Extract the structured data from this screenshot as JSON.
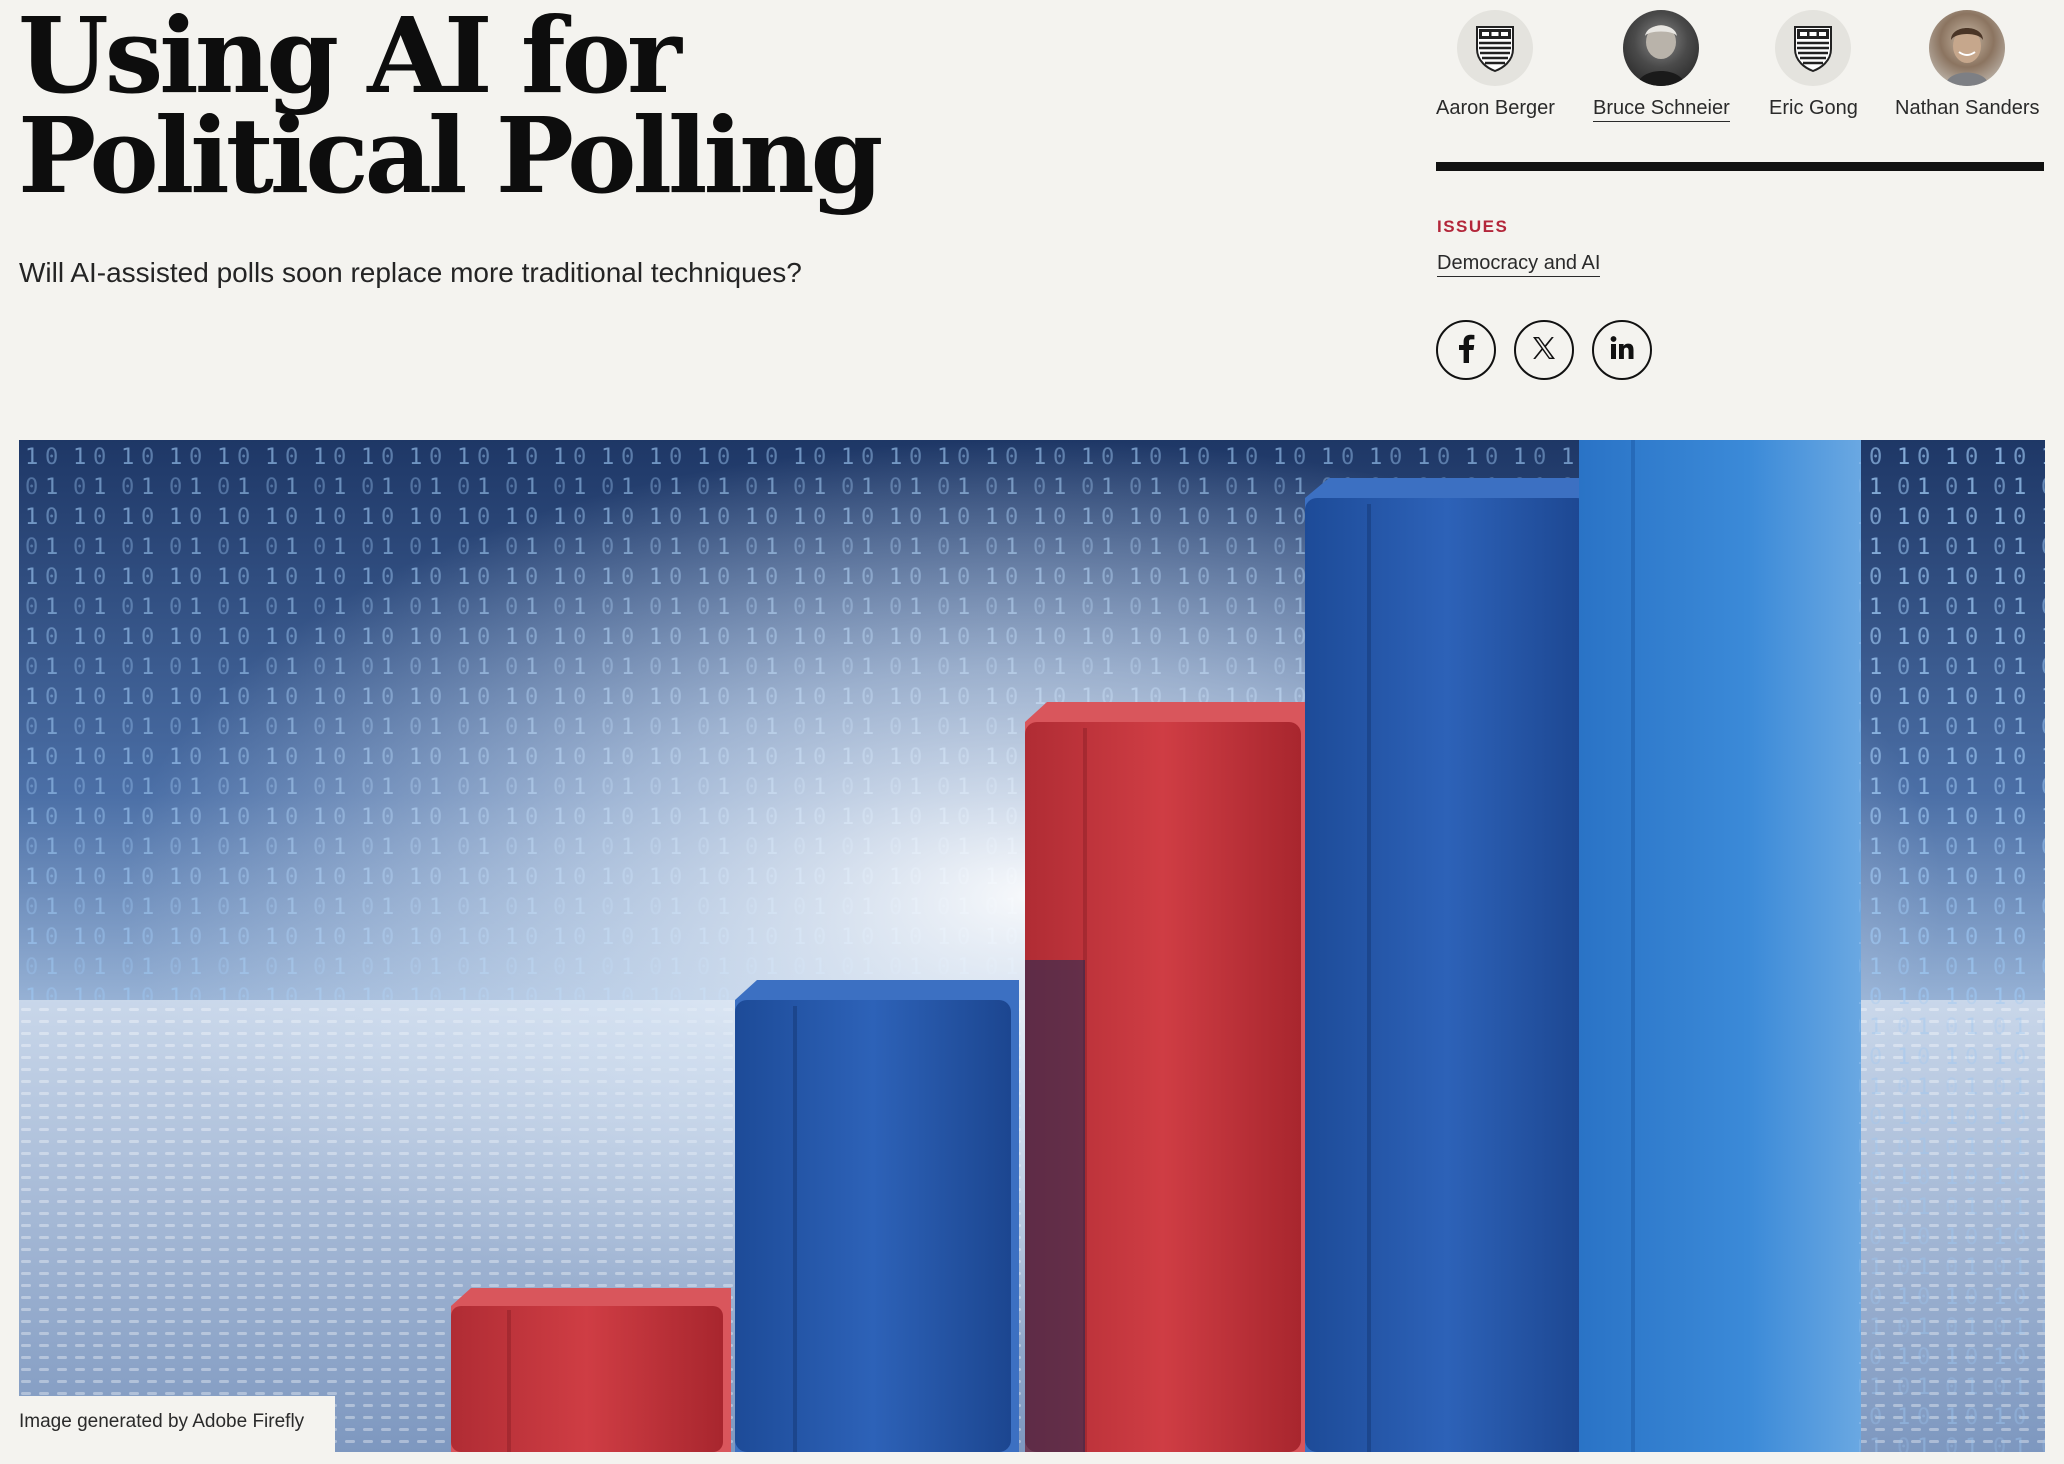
{
  "article": {
    "title": "Using AI for Political Polling",
    "dek": "Will AI-assisted polls soon replace more traditional techniques?"
  },
  "authors": [
    {
      "name": "Aaron Berger",
      "avatar": "shield-icon",
      "linked": false
    },
    {
      "name": "Bruce Schneier",
      "avatar": "author-photo",
      "linked": true
    },
    {
      "name": "Eric Gong",
      "avatar": "shield-icon",
      "linked": false
    },
    {
      "name": "Nathan Sanders",
      "avatar": "author-photo",
      "linked": false
    }
  ],
  "issues": {
    "label": "ISSUES",
    "items": [
      "Democracy and AI"
    ]
  },
  "share": {
    "facebook": "facebook-icon",
    "x": "x-icon",
    "linkedin": "linkedin-icon"
  },
  "hero": {
    "caption": "Image generated by Adobe Firefly",
    "colors": {
      "red": "#c0343c",
      "blue": "#2456a8",
      "light_blue": "#2f7fd0"
    }
  },
  "colors": {
    "background": "#f4f3ef",
    "accent": "#b3263a",
    "text": "#141414"
  }
}
